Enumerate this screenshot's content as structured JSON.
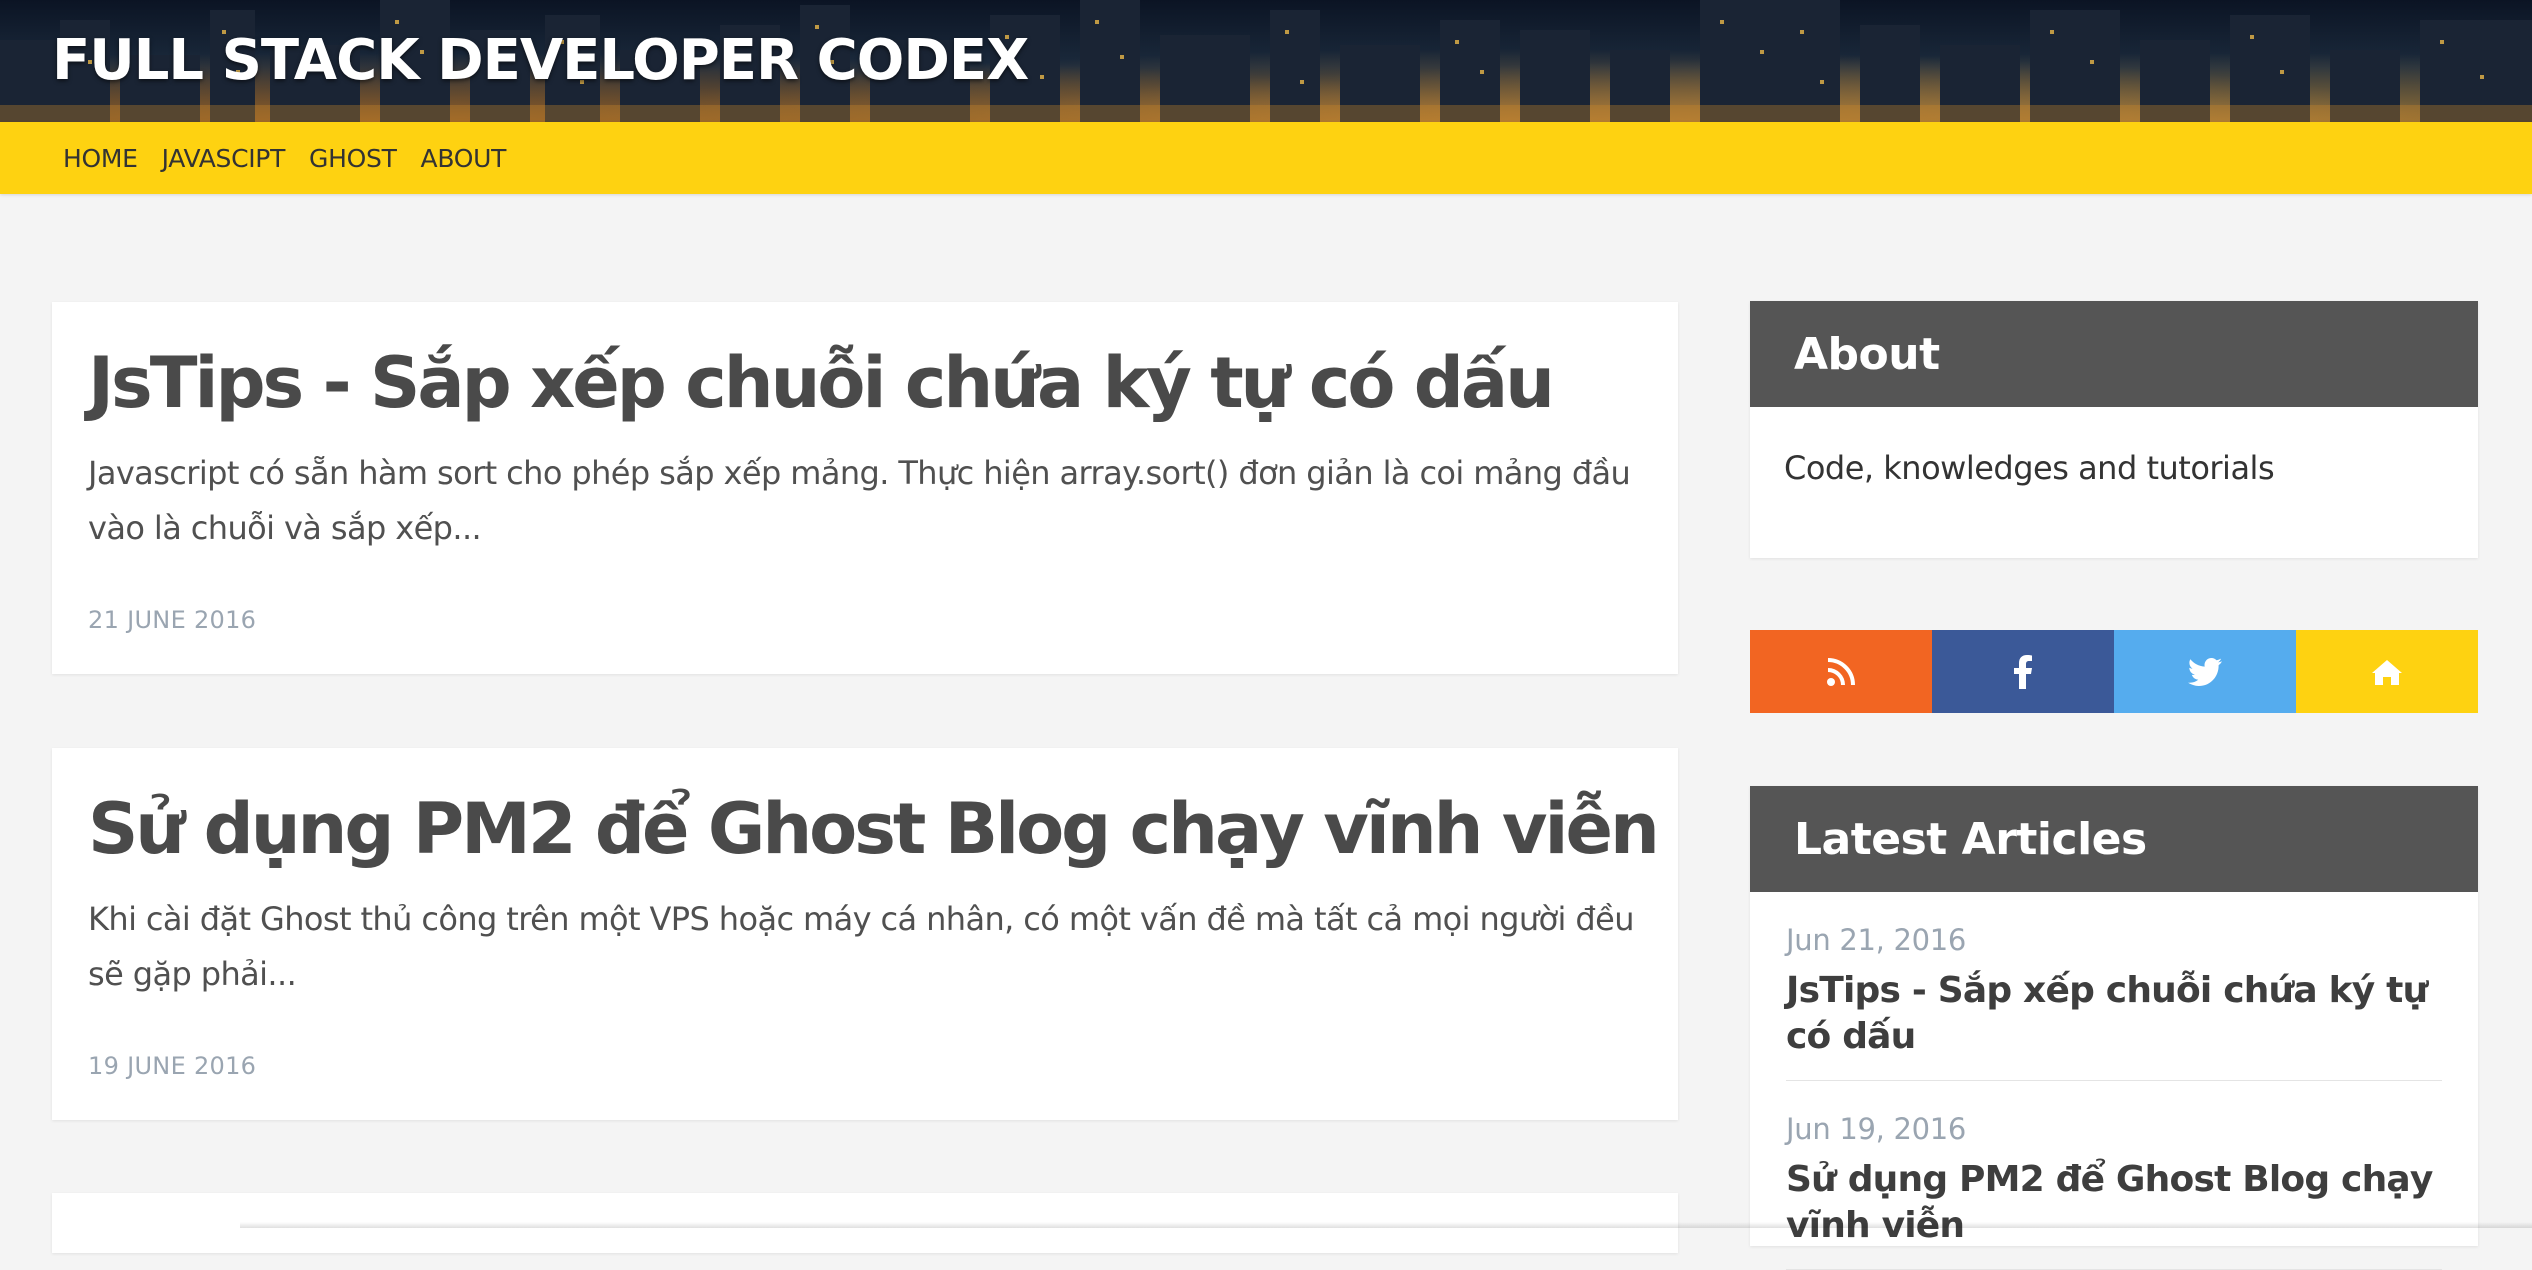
{
  "header": {
    "site_title": "FULL STACK DEVELOPER CODEX"
  },
  "nav": {
    "items": [
      {
        "label": "HOME"
      },
      {
        "label": "JAVASCIPT"
      },
      {
        "label": "GHOST"
      },
      {
        "label": "ABOUT"
      }
    ]
  },
  "posts": [
    {
      "title": "JsTips - Sắp xếp chuỗi chứa ký tự có dấu",
      "excerpt": "Javascript có sẵn hàm sort cho phép sắp xếp mảng. Thực hiện array.sort() đơn giản là coi mảng đầu vào là chuỗi và sắp xếp...",
      "date": "21 JUNE 2016"
    },
    {
      "title": "Sử dụng PM2 để Ghost Blog chạy vĩnh viễn",
      "excerpt": "Khi cài đặt Ghost thủ công trên một VPS hoặc máy cá nhân, có một vấn đề mà tất cả mọi người đều sẽ gặp phải...",
      "date": "19 JUNE 2016"
    }
  ],
  "sidebar": {
    "about": {
      "title": "About",
      "text": "Code, knowledges and tutorials"
    },
    "social": [
      {
        "icon": "rss-icon",
        "color": "#f26522"
      },
      {
        "icon": "facebook-icon",
        "color": "#3b5998"
      },
      {
        "icon": "twitter-icon",
        "color": "#55acee"
      },
      {
        "icon": "home-icon",
        "color": "#fed211"
      }
    ],
    "latest": {
      "title": "Latest Articles",
      "items": [
        {
          "date": "Jun 21, 2016",
          "title": "JsTips - Sắp xếp chuỗi chứa ký tự có dấu"
        },
        {
          "date": "Jun 19, 2016",
          "title": "Sử dụng PM2 để Ghost Blog chạy vĩnh viễn"
        }
      ]
    }
  },
  "colors": {
    "nav_background": "#fed211",
    "widget_header": "#555555",
    "date_gray": "#9aa5b1"
  }
}
